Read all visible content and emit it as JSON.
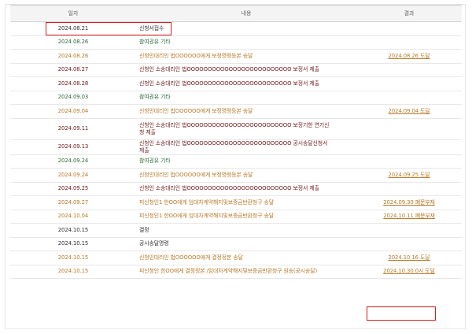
{
  "headers": {
    "date": "일자",
    "content": "내용",
    "result": "결과"
  },
  "rows": [
    {
      "date": "2024.08.21",
      "content": "신청서접수",
      "result": "",
      "tone": "black"
    },
    {
      "date": "2024.08.26",
      "content": "참여권유 기타",
      "result": "",
      "tone": "green"
    },
    {
      "date": "2024.08.26",
      "content": "신청인대리인 법OOOOOO에게 보정명령등본 송달",
      "result": "2024.08.26 도달",
      "tone": "orange"
    },
    {
      "date": "2024.08.27",
      "content": "신청인 소송대리인 법OOOOOOOOOOOOOOOOOOOOOOOOO 보정서 제출",
      "result": "",
      "tone": "maroon"
    },
    {
      "date": "2024.08.28",
      "content": "신청인 소송대리인 법OOOOOOOOOOOOOOOOOOOOOOOOO 보정서 제출",
      "result": "",
      "tone": "maroon"
    },
    {
      "date": "2024.09.03",
      "content": "참여권유 기타",
      "result": "",
      "tone": "green"
    },
    {
      "date": "2024.09.04",
      "content": "신청인대리인 법OOOOOO에게 보정명령등본 송달",
      "result": "2024.09.04 도달",
      "tone": "orange"
    },
    {
      "date": "2024.09.11",
      "content": "신청인 소송대리인 법OOOOOOOOOOOOOOOOOOOOOOOOO 보정기한 연기신청 제출",
      "result": "",
      "tone": "maroon",
      "tall": true
    },
    {
      "date": "2024.09.13",
      "content": "신청인 소송대리인 법OOOOOOOOOOOOOOOOOOOOOOOOO 공시송달신청서 제출",
      "result": "",
      "tone": "maroon"
    },
    {
      "date": "2024.09.24",
      "content": "참여권유 기타",
      "result": "",
      "tone": "green"
    },
    {
      "date": "2024.09.24",
      "content": "신청인대리인 법OOOOOO에게 보정명령등본 송달",
      "result": "2024.09.25 도달",
      "tone": "orange"
    },
    {
      "date": "2024.09.25",
      "content": "신청인 소송대리인 법OOOOOOOOOOOOOOOOOOOOOOOOO 보정서 제출",
      "result": "",
      "tone": "maroon"
    },
    {
      "date": "2024.09.27",
      "content": "피신청인1 한OO에게 임대차계약해지및보증금반환청구 송달",
      "result": "2024.09.30 폐문부재",
      "tone": "orange"
    },
    {
      "date": "2024.10.04",
      "content": "피신청인1 한OO에게 임대차계약해지및보증금반환청구 송달",
      "result": "2024.10.11 폐문부재",
      "tone": "orange"
    },
    {
      "date": "2024.10.15",
      "content": "결정",
      "result": "",
      "tone": "black"
    },
    {
      "date": "2024.10.15",
      "content": "공시송달명령",
      "result": "",
      "tone": "black"
    },
    {
      "date": "2024.10.15",
      "content": "신청인대리인 법OOOOOO에게 결정정본 송달",
      "result": "2024.10.16 도달",
      "tone": "orange"
    },
    {
      "date": "2024.10.15",
      "content": "피신청인 한OO에게 결정정본 /임대차계약해지및보증금반환청구 원송(공시송달)",
      "result": "2024.10.30 0시 도달",
      "tone": "orange"
    }
  ],
  "colors": {
    "black": "#333333",
    "green": "#2f6b3a",
    "orange": "#b87a2a",
    "maroon": "#6e1a1a",
    "highlight": "#d91a1a"
  }
}
